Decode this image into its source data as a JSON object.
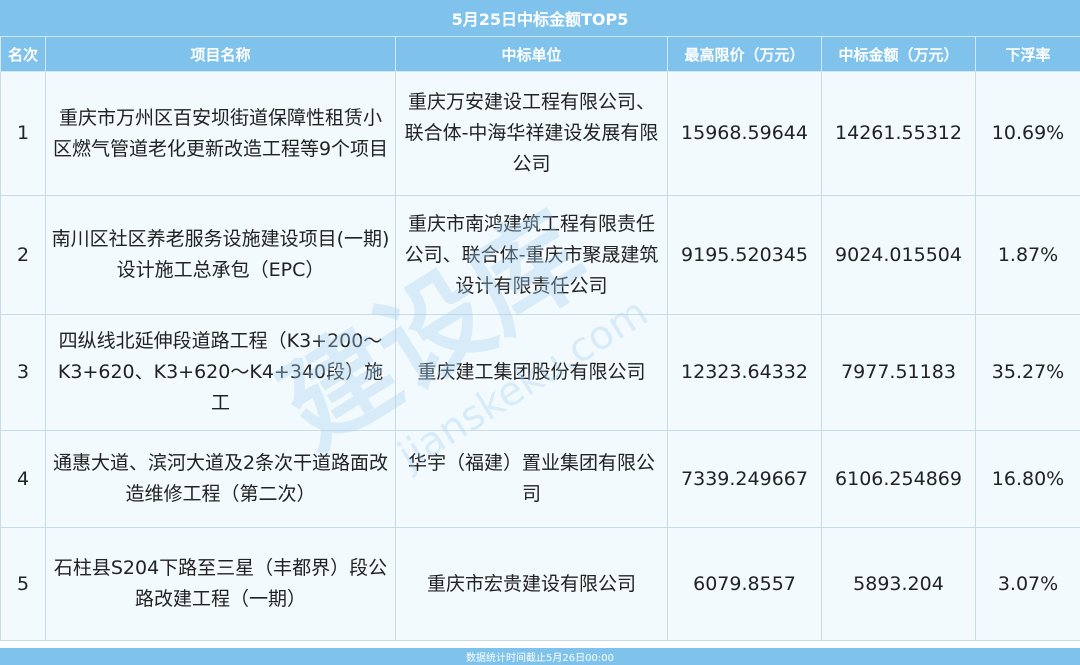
{
  "title": "5月25日中标金额TOP5",
  "headers": [
    "名次",
    "项目名称",
    "中标单位",
    "最高限价（万元）",
    "中标金额（万元）",
    "下浮率"
  ],
  "rows": [
    {
      "rank": "1",
      "project": "重庆市万州区百安坝街道保障性租赁小区燃气管道老化更新改造工程等9个项目",
      "winner": "重庆万安建设工程有限公司、联合体-中海华祥建设发展有限公司",
      "max_price": "15968.59644",
      "bid_amount": "14261.55312",
      "discount": "10.69%"
    },
    {
      "rank": "2",
      "project": "南川区社区养老服务设施建设项目(一期)设计施工总承包（EPC）",
      "winner": "重庆市南鸿建筑工程有限责任公司、联合体-重庆市聚晟建筑设计有限责任公司",
      "max_price": "9195.520345",
      "bid_amount": "9024.015504",
      "discount": "1.87%"
    },
    {
      "rank": "3",
      "project": "四纵线北延伸段道路工程（K3+200～K3+620、K3+620～K4+340段）施工",
      "winner": "重庆建工集团股份有限公司",
      "max_price": "12323.64332",
      "bid_amount": "7977.51183",
      "discount": "35.27%"
    },
    {
      "rank": "4",
      "project": "通惠大道、滨河大道及2条次干道路面改造维修工程（第二次）",
      "winner": "华宇（福建）置业集团有限公司",
      "max_price": "7339.249667",
      "bid_amount": "6106.254869",
      "discount": "16.80%"
    },
    {
      "rank": "5",
      "project": "石柱县S204下路至三星（丰都界）段公路改建工程（一期）",
      "winner": "重庆市宏贵建设有限公司",
      "max_price": "6079.8557",
      "bid_amount": "5893.204",
      "discount": "3.07%"
    }
  ],
  "footer": "数据统计时间截止5月26日00:00",
  "watermark": {
    "main": "建设库",
    "sub": "jianskeku.com"
  },
  "colors": {
    "header_bg": "#7fc3ec",
    "cell_bg": "#f2fafe",
    "border": "#c8dbe7"
  }
}
